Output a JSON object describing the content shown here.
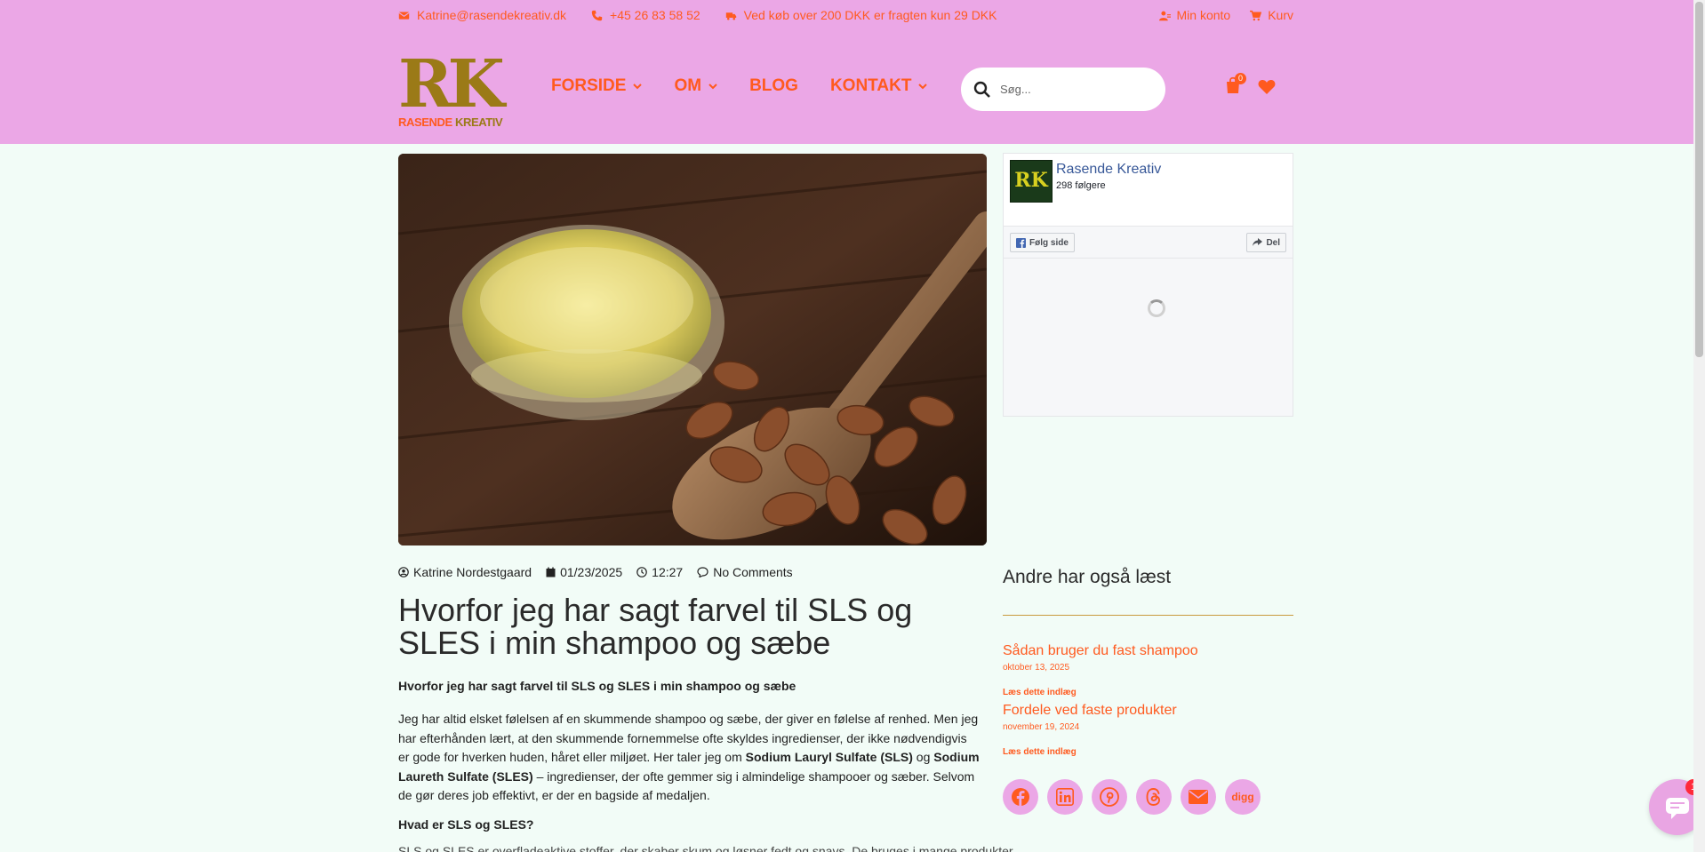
{
  "topbar": {
    "email": "Katrine@rasendekreativ.dk",
    "phone": "+45 26 83 58 52",
    "shipping": "Ved køb over 200 DKK er fragten kun 29 DKK",
    "account": "Min konto",
    "cart": "Kurv"
  },
  "logo": {
    "mark": "RK",
    "word1": "RASENDE",
    "word2": "KREATIV"
  },
  "nav": {
    "items": [
      {
        "label": "FORSIDE",
        "has_dropdown": true
      },
      {
        "label": "OM",
        "has_dropdown": true
      },
      {
        "label": "BLOG",
        "has_dropdown": false
      },
      {
        "label": "KONTAKT",
        "has_dropdown": true
      }
    ]
  },
  "search": {
    "placeholder": "Søg..."
  },
  "cart_count": "0",
  "post": {
    "author": "Katrine Nordestgaard",
    "date": "01/23/2025",
    "time": "12:27",
    "comments": "No Comments",
    "title": "Hvorfor jeg har sagt farvel til SLS og SLES i min shampoo og sæbe",
    "subheading": "Hvorfor jeg har sagt farvel til SLS og SLES i min shampoo og sæbe",
    "intro_part1": "Jeg har altid elsket følelsen af en skummende shampoo og sæbe, der giver en følelse af renhed. Men jeg har efterhånden lært, at den skummende fornemmelse ofte skyldes ingredienser, der ikke nødvendigvis er gode for hverken huden, håret eller miljøet. Her taler jeg om ",
    "intro_bold1": "Sodium Lauryl Sulfate (SLS)",
    "intro_part2": " og ",
    "intro_bold2": "Sodium Laureth Sulfate (SLES)",
    "intro_part3": " – ingredienser, der ofte gemmer sig i almindelige shampooer og sæber. Selvom de gør deres job effektivt, er der en bagside af medaljen.",
    "section_heading": "Hvad er SLS og SLES?",
    "section_text_cut": "SLS og SLES er overfladeaktive stoffer, der skaber skum og løsner fedt og snavs. De bruges i mange produkter"
  },
  "facebook": {
    "page_name": "Rasende Kreativ",
    "followers": "298 følgere",
    "follow_label": "Følg side",
    "share_label": "Del"
  },
  "sidebar": {
    "heading": "Andre har også læst",
    "posts": [
      {
        "title": "Sådan bruger du fast shampoo",
        "date": "oktober 13, 2025",
        "link": "Læs dette indlæg"
      },
      {
        "title": "Fordele ved faste produkter",
        "date": "november 19, 2024",
        "link": "Læs dette indlæg"
      }
    ],
    "share_icons": [
      "facebook-icon",
      "linkedin-icon",
      "pinterest-icon",
      "threads-icon",
      "email-icon",
      "digg-icon"
    ],
    "digg_label": "digg"
  },
  "chat": {
    "badge": "1"
  },
  "colors": {
    "header_bg": "#eba7e6",
    "accent": "#ff5a1f",
    "gold": "#9b7a17",
    "page_bg": "#f2fcf7"
  }
}
